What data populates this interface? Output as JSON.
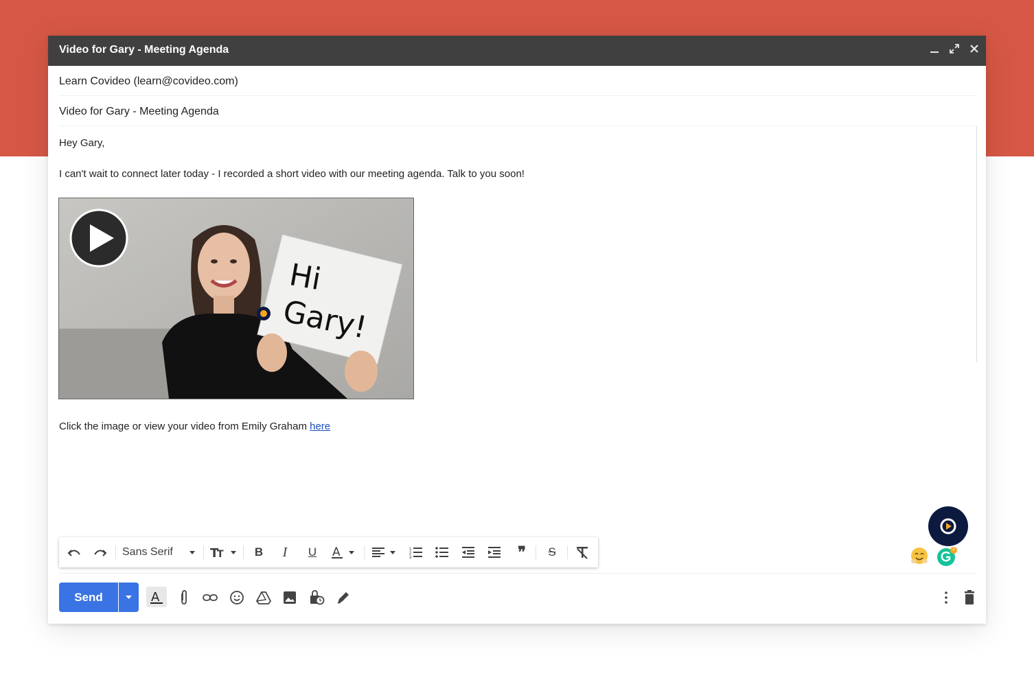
{
  "window": {
    "title": "Video for Gary - Meeting Agenda"
  },
  "fields": {
    "from": "Learn Covideo (learn@covideo.com)",
    "subject": "Video for Gary - Meeting Agenda"
  },
  "body": {
    "greeting": "Hey Gary,",
    "paragraph": "I can't wait to connect later today - I recorded a short video with our meeting agenda. Talk to you soon!",
    "video_sign_line1": "Hi",
    "video_sign_line2": "Gary!",
    "footer_text": "Click the image or view your video from Emily Graham ",
    "footer_link": "here"
  },
  "toolbar": {
    "font_name": "Sans Serif",
    "icons": [
      "undo-icon",
      "redo-icon",
      "font-size-icon",
      "bold-icon",
      "italic-icon",
      "underline-icon",
      "text-color-icon",
      "align-icon",
      "numbered-list-icon",
      "bulleted-list-icon",
      "indent-less-icon",
      "indent-more-icon",
      "quote-icon",
      "strikethrough-icon",
      "remove-formatting-icon"
    ]
  },
  "actions": {
    "send_label": "Send",
    "grammarly_badge": "1"
  },
  "colors": {
    "banner": "#d65745",
    "titlebar": "#404040",
    "send": "#3a73e3",
    "link": "#1a4fc4",
    "covideo": "#0d1a40"
  }
}
